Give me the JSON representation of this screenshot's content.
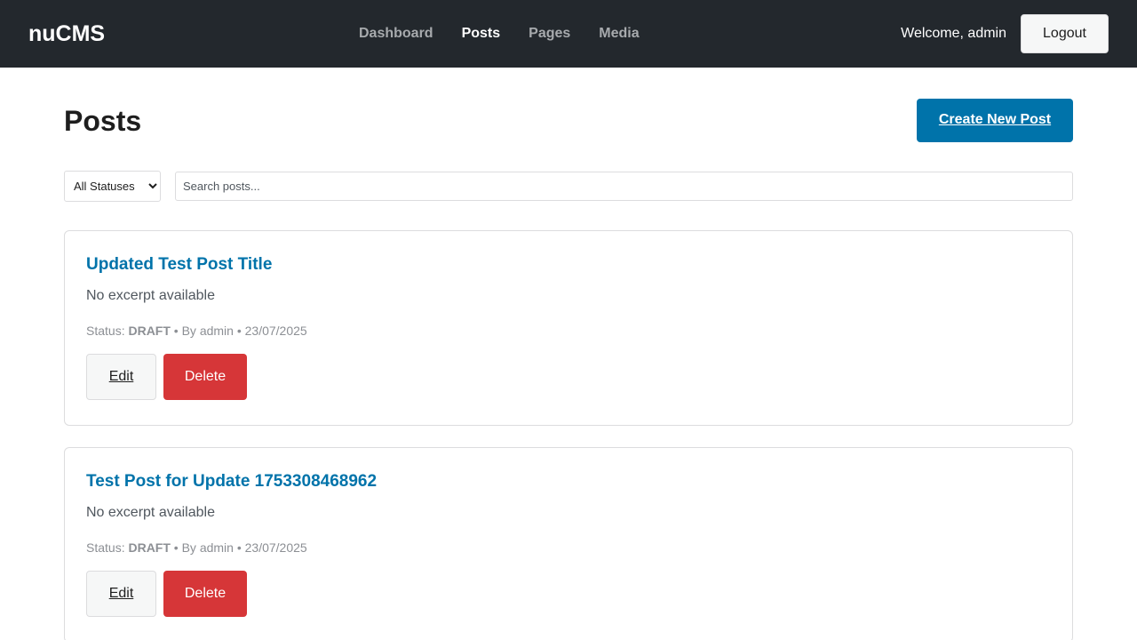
{
  "brand": "nuCMS",
  "nav": {
    "items": [
      {
        "label": "Dashboard",
        "active": false
      },
      {
        "label": "Posts",
        "active": true
      },
      {
        "label": "Pages",
        "active": false
      },
      {
        "label": "Media",
        "active": false
      }
    ]
  },
  "user": {
    "welcome": "Welcome, admin",
    "logout_label": "Logout"
  },
  "page": {
    "title": "Posts",
    "create_label": "Create New Post"
  },
  "filters": {
    "status_selected": "All Statuses",
    "search_placeholder": "Search posts..."
  },
  "posts": [
    {
      "title": "Updated Test Post Title",
      "excerpt": "No excerpt available",
      "status_prefix": "Status: ",
      "status": "DRAFT",
      "author": " • By admin",
      "date": " • 23/07/2025",
      "edit_label": "Edit",
      "delete_label": "Delete"
    },
    {
      "title": "Test Post for Update 1753308468962",
      "excerpt": "No excerpt available",
      "status_prefix": "Status: ",
      "status": "DRAFT",
      "author": " • By admin",
      "date": " • 23/07/2025",
      "edit_label": "Edit",
      "delete_label": "Delete"
    }
  ],
  "colors": {
    "topbar": "#23282d",
    "accent": "#0073aa",
    "danger": "#d63638"
  }
}
